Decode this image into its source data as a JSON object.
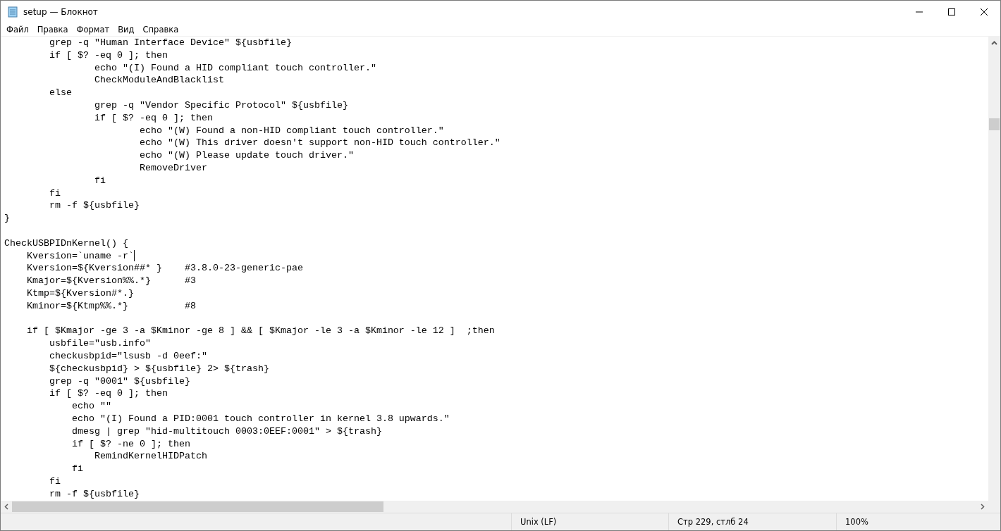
{
  "window": {
    "title": "setup — Блокнот"
  },
  "menu": [
    "Файл",
    "Правка",
    "Формат",
    "Вид",
    "Справка"
  ],
  "lines": [
    {
      "kind": "code",
      "text": "        grep -q \"Human Interface Device\" ${usbfile}",
      "cursor": false
    },
    {
      "kind": "code",
      "text": "        if [ $? -eq 0 ]; then",
      "cursor": false
    },
    {
      "kind": "code",
      "text": "                echo \"(I) Found a HID compliant touch controller.\"",
      "cursor": false
    },
    {
      "kind": "code",
      "text": "                CheckModuleAndBlacklist",
      "cursor": false
    },
    {
      "kind": "code",
      "text": "        else",
      "cursor": false
    },
    {
      "kind": "code",
      "text": "                grep -q \"Vendor Specific Protocol\" ${usbfile}",
      "cursor": false
    },
    {
      "kind": "code",
      "text": "                if [ $? -eq 0 ]; then",
      "cursor": false
    },
    {
      "kind": "code",
      "text": "                        echo \"(W) Found a non-HID compliant touch controller.\"",
      "cursor": false
    },
    {
      "kind": "code",
      "text": "                        echo \"(W) This driver doesn't support non-HID touch controller.\"",
      "cursor": false
    },
    {
      "kind": "code",
      "text": "                        echo \"(W) Please update touch driver.\"",
      "cursor": false
    },
    {
      "kind": "code",
      "text": "                        RemoveDriver",
      "cursor": false
    },
    {
      "kind": "code",
      "text": "                fi",
      "cursor": false
    },
    {
      "kind": "code",
      "text": "        fi",
      "cursor": false
    },
    {
      "kind": "code",
      "text": "        rm -f ${usbfile}",
      "cursor": false
    },
    {
      "kind": "code",
      "text": "}",
      "cursor": false
    },
    {
      "kind": "blank",
      "cursor": false
    },
    {
      "kind": "code",
      "text": "CheckUSBPIDnKernel() {",
      "cursor": false
    },
    {
      "kind": "code",
      "text": "    Kversion=`uname -r`",
      "cursor": true
    },
    {
      "kind": "code",
      "text": "    Kversion=${Kversion##* }    #3.8.0-23-generic-pae",
      "cursor": false
    },
    {
      "kind": "code",
      "text": "    Kmajor=${Kversion%%.*}      #3",
      "cursor": false
    },
    {
      "kind": "code",
      "text": "    Ktmp=${Kversion#*.}",
      "cursor": false
    },
    {
      "kind": "code",
      "text": "    Kminor=${Ktmp%%.*}          #8",
      "cursor": false
    },
    {
      "kind": "blank",
      "cursor": false
    },
    {
      "kind": "code",
      "text": "    if [ $Kmajor -ge 3 -a $Kminor -ge 8 ] && [ $Kmajor -le 3 -a $Kminor -le 12 ]  ;then",
      "cursor": false
    },
    {
      "kind": "code",
      "text": "        usbfile=\"usb.info\"",
      "cursor": false
    },
    {
      "kind": "code",
      "text": "        checkusbpid=\"lsusb -d 0eef:\"",
      "cursor": false
    },
    {
      "kind": "code",
      "text": "        ${checkusbpid} > ${usbfile} 2> ${trash}",
      "cursor": false
    },
    {
      "kind": "code",
      "text": "        grep -q \"0001\" ${usbfile}",
      "cursor": false
    },
    {
      "kind": "code",
      "text": "        if [ $? -eq 0 ]; then",
      "cursor": false
    },
    {
      "kind": "code",
      "text": "            echo \"\"",
      "cursor": false
    },
    {
      "kind": "code",
      "text": "            echo \"(I) Found a PID:0001 touch controller in kernel 3.8 upwards.\"",
      "cursor": false
    },
    {
      "kind": "code",
      "text": "            dmesg | grep \"hid-multitouch 0003:0EEF:0001\" > ${trash}",
      "cursor": false
    },
    {
      "kind": "code",
      "text": "            if [ $? -ne 0 ]; then",
      "cursor": false
    },
    {
      "kind": "code",
      "text": "                RemindKernelHIDPatch",
      "cursor": false
    },
    {
      "kind": "code",
      "text": "            fi",
      "cursor": false
    },
    {
      "kind": "code",
      "text": "        fi",
      "cursor": false
    },
    {
      "kind": "code",
      "text": "        rm -f ${usbfile}",
      "cursor": false
    }
  ],
  "status_bar": {
    "line_ending": "Unix (LF)",
    "position": "Стр 229, стлб 24",
    "zoom": "100%"
  }
}
